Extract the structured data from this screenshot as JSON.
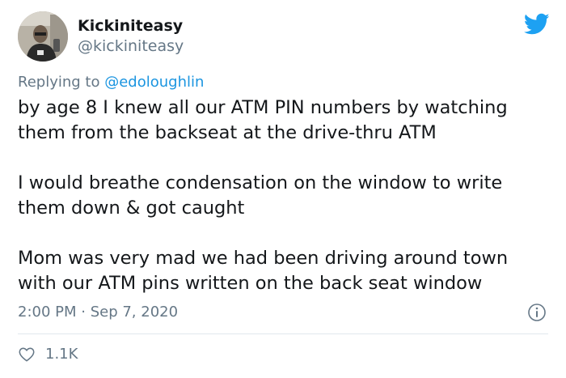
{
  "user": {
    "display_name": "Kickiniteasy",
    "handle": "@kickiniteasy"
  },
  "reply": {
    "prefix": "Replying to ",
    "mention": "@edoloughlin"
  },
  "tweet": {
    "paragraphs": [
      "by age 8 I knew all our ATM PIN numbers by watching\nthem from the backseat at the drive-thru ATM",
      "I would breathe condensation on the window to write\nthem down & got caught",
      "Mom was very mad we had been driving around town\nwith our ATM pins written on the back seat window"
    ],
    "timestamp": "2:00 PM · Sep 7, 2020"
  },
  "actions": {
    "like_count": "1.1K"
  },
  "icons": {
    "brand": "twitter-bird-icon",
    "info": "info-icon",
    "like": "heart-icon"
  },
  "colors": {
    "brand_blue": "#1da1f2",
    "link_blue": "#1b95e0",
    "muted_gray": "#657786",
    "text": "#14171a",
    "divider": "#e1e8ed"
  }
}
